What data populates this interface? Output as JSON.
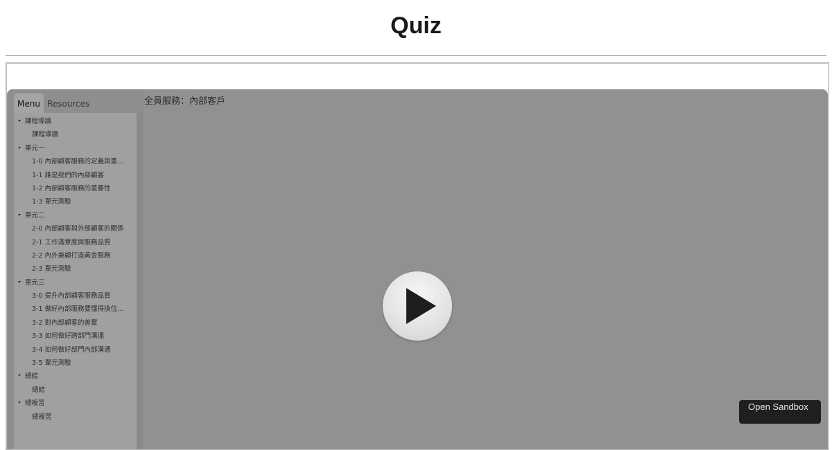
{
  "page": {
    "title": "Quiz"
  },
  "sidebar": {
    "tabs": [
      {
        "label": "Menu",
        "active": true
      },
      {
        "label": "Resources",
        "active": false
      }
    ],
    "menu": [
      {
        "label": "課程導讀",
        "items": [
          "課程導讀"
        ]
      },
      {
        "label": "單元一",
        "items": [
          "1-0 內部顧客服務的定義與重…",
          "1-1 誰是我們的內部顧客",
          "1-2 內部顧客服務的重要性",
          "1-3 單元測驗"
        ]
      },
      {
        "label": "單元二",
        "items": [
          "2-0 內部顧客與外部顧客的關係",
          "2-1 工作滿意度與服務品質",
          "2-2 內外兼顧打造黃金服務",
          "2-3 單元測驗"
        ]
      },
      {
        "label": "單元三",
        "items": [
          "3-0 提升內部顧客服務品質",
          "3-1 做好內部服務要懂得換位…",
          "3-2 對內部顧客的善實",
          "3-3 如何做好跨部門溝通",
          "3-4 如何做好部門內部溝通",
          "3-5 單元測驗"
        ]
      },
      {
        "label": "總結",
        "items": [
          "總結"
        ]
      },
      {
        "label": "總複習",
        "items": [
          "總複習"
        ]
      }
    ]
  },
  "player": {
    "slide_title": "全員服務：內部客戶",
    "play_icon": "play-icon",
    "sandbox_label": "Open Sandbox"
  },
  "colors": {
    "player_bg": "#919191",
    "menu_bg": "#a0a0a0",
    "sandbox_bg": "#1f1f1f"
  }
}
